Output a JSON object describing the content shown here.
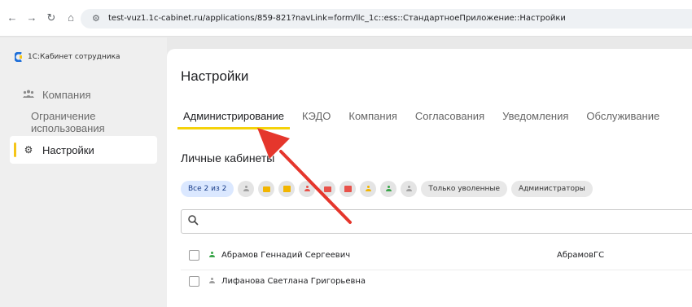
{
  "browser": {
    "url": "test-vuz1.1c-cabinet.ru/applications/859-821?navLink=form/llc_1c::ess::СтандартноеПриложение::Настройки"
  },
  "brand": {
    "name": "1С:Кабинет сотрудника",
    "logo_color": "#1e6fd9"
  },
  "sidebar": {
    "items": [
      {
        "label": "Компания",
        "icon": "people-icon"
      },
      {
        "label": "Ограничение использования"
      },
      {
        "label": "Настройки",
        "icon": "gear-icon",
        "active": true
      }
    ]
  },
  "page": {
    "title": "Настройки"
  },
  "tabs": [
    {
      "label": "Администрирование",
      "active": true
    },
    {
      "label": "КЭДО"
    },
    {
      "label": "Компания"
    },
    {
      "label": "Согласования"
    },
    {
      "label": "Уведомления"
    },
    {
      "label": "Обслуживание"
    }
  ],
  "section": {
    "title": "Личные кабинеты"
  },
  "filters": {
    "count_chip": "Все 2 из 2",
    "icon_chips": [
      {
        "icon": "person-icon",
        "color": "#9e9e9e"
      },
      {
        "icon": "mail-icon",
        "color": "#f2b500"
      },
      {
        "icon": "chat-icon",
        "color": "#f2b500"
      },
      {
        "icon": "person-icon",
        "color": "#e8514a"
      },
      {
        "icon": "mail-icon",
        "color": "#e8514a"
      },
      {
        "icon": "chat-icon",
        "color": "#e8514a"
      },
      {
        "icon": "person-icon",
        "color": "#f2b500"
      },
      {
        "icon": "person-icon",
        "color": "#3aa54a"
      },
      {
        "icon": "person-icon",
        "color": "#9e9e9e"
      }
    ],
    "fired_chip": "Только уволенные",
    "admins_chip": "Администраторы"
  },
  "search": {
    "placeholder": ""
  },
  "users": [
    {
      "name": "Абрамов Геннадий Сергеевич",
      "login": "АбрамовГС",
      "status_color": "#3aa54a"
    },
    {
      "name": "Лифанова Светлана Григорьевна",
      "login": "",
      "status_color": "#9e9e9e"
    }
  ],
  "annotation": {
    "arrow_color": "#e5362c"
  }
}
